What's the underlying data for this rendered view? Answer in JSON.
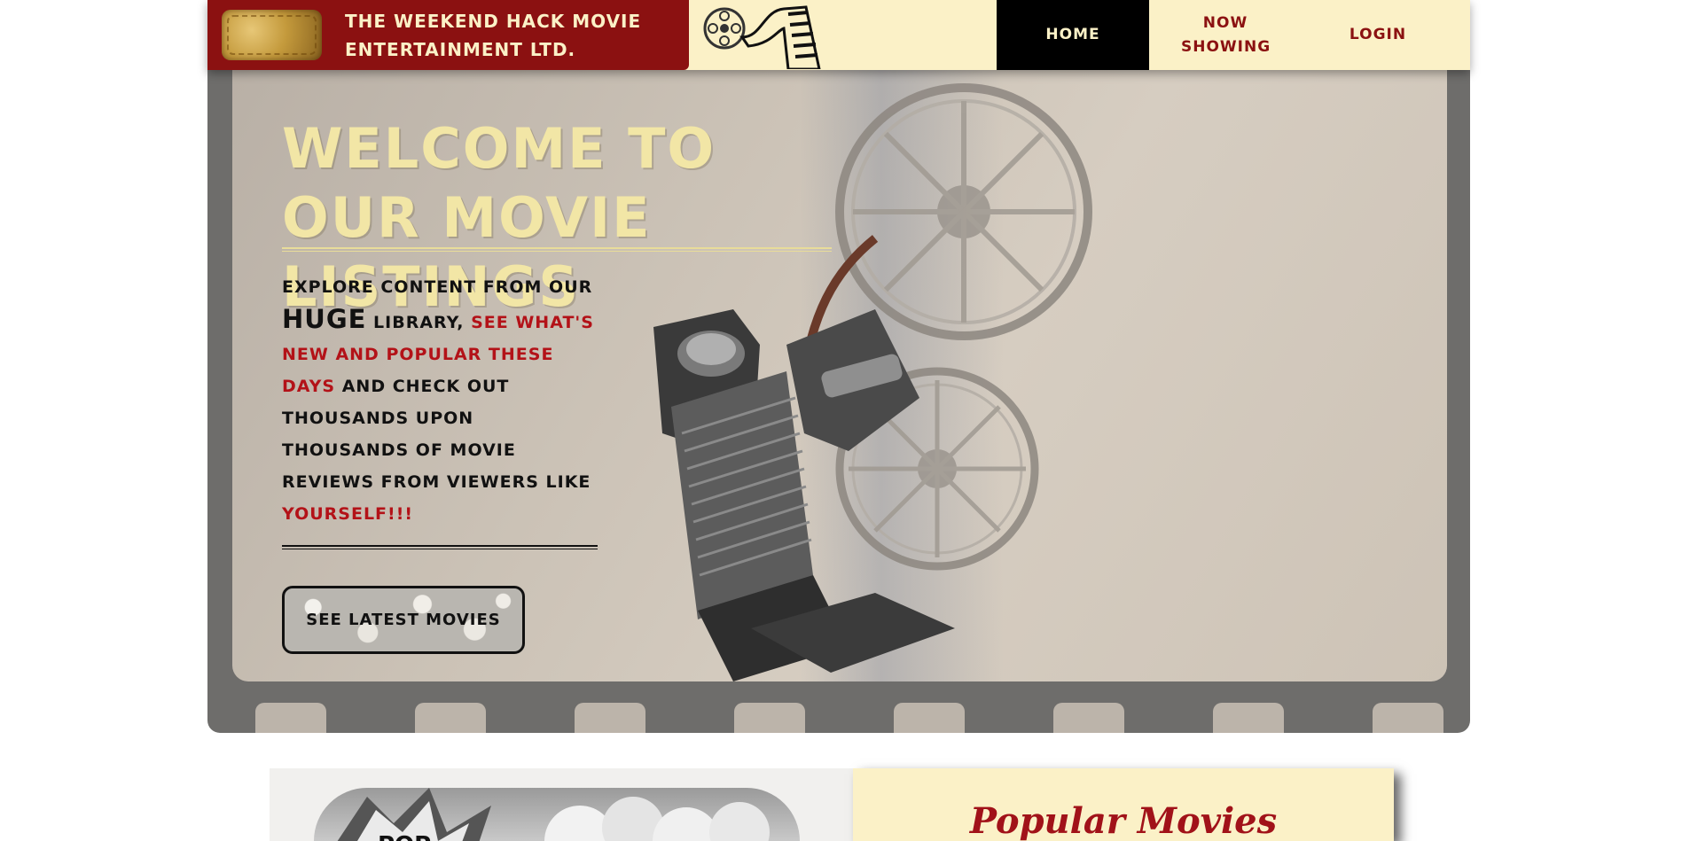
{
  "header": {
    "brand_name": "THE WEEKEND HACK MOVIE ENTERTAINMENT LTD.",
    "logo_icon": "ticket-icon",
    "reel_icon": "film-reel-icon",
    "nav": {
      "home": "HOME",
      "now_showing": "NOW SHOWING",
      "login": "LOGIN"
    },
    "colors": {
      "brand": "#8b1111",
      "cream": "#fbf1c7",
      "active": "#000000"
    }
  },
  "hero": {
    "title": "WELCOME TO OUR MOVIE LISTINGS",
    "text": {
      "part1": "EXPLORE CONTENT FROM OUR ",
      "big": "HUGE",
      "part2": " LIBRARY, ",
      "red1": "SEE WHAT'S NEW AND POPULAR THESE DAYS",
      "part3": " AND CHECK OUT THOUSANDS UPON THOUSANDS OF MOVIE REVIEWS FROM VIEWERS LIKE ",
      "red2": "YOURSELF!!!"
    },
    "cta_label": "SEE LATEST MOVIES",
    "background_icon": "film-projector-icon",
    "colors": {
      "title": "#f2e6a6",
      "accent": "#b31218"
    }
  },
  "sections": {
    "promo_image_label": "POP",
    "popular_title": "Popular Movies"
  }
}
